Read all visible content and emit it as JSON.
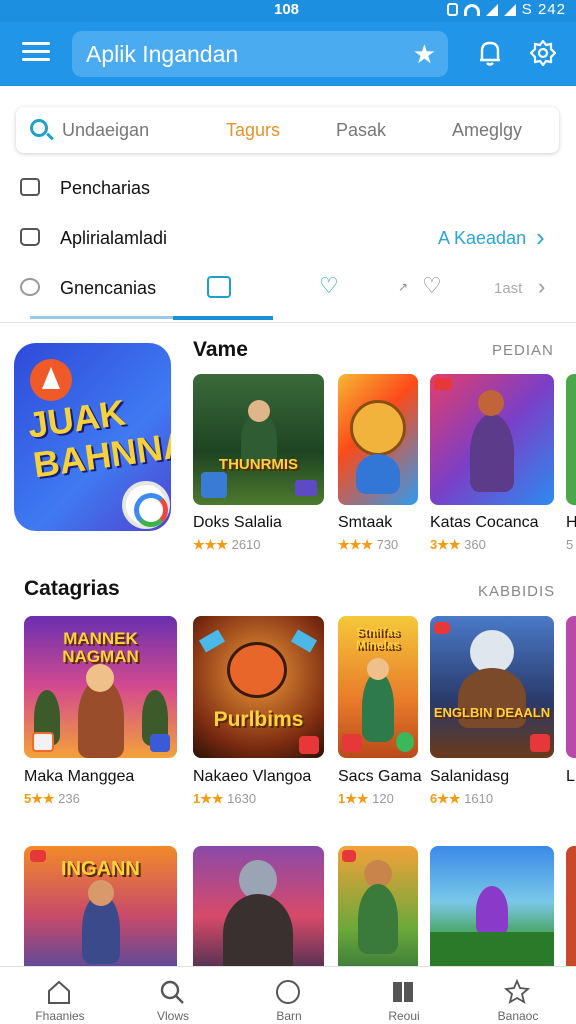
{
  "status_bar": {
    "time": "108",
    "battery": "S 242"
  },
  "app_bar": {
    "title": "Aplik Ingandan",
    "icons": [
      "menu-icon",
      "star-icon",
      "bell-icon",
      "gear-icon"
    ]
  },
  "tabs": [
    {
      "label": "Undaeigan",
      "active": false
    },
    {
      "label": "Tagurs",
      "active": true
    },
    {
      "label": "Pasak",
      "active": false
    },
    {
      "label": "Ameglgy",
      "active": false
    }
  ],
  "rows": {
    "row1": {
      "label": "Pencharias"
    },
    "row2": {
      "label": "Aplirialamladi",
      "right_text": "A Kaeadan"
    },
    "row3": {
      "label": "Gnencanias",
      "right_text": "1ast"
    }
  },
  "featured": {
    "title_line1": "JUAK",
    "title_line2": "BAHNNA"
  },
  "section1": {
    "title": "Vame",
    "link": "PEDIAN",
    "apps": [
      {
        "name": "Doks Salalia",
        "stars": "★★★",
        "count": "2610"
      },
      {
        "name": "Smtaak",
        "stars": "★★★",
        "count": "730"
      },
      {
        "name": "Katas Cocanca",
        "stars": "3★★",
        "count": "360"
      },
      {
        "name": "H",
        "stars": "",
        "count": "5"
      }
    ],
    "thumb_titles": [
      "THUNRMIS"
    ]
  },
  "section2": {
    "title": "Catagrias",
    "link": "KABBIDIS",
    "apps": [
      {
        "name": "Maka Manggea",
        "stars": "5★★",
        "count": "236",
        "thumb_title": "MANNEK NAGMAN"
      },
      {
        "name": "Nakaeo Vlangoa",
        "stars": "1★★",
        "count": "1630",
        "thumb_title": "Purlbims"
      },
      {
        "name": "Sacs Gama",
        "stars": "1★★",
        "count": "120",
        "thumb_title": "Stnilfas Minelas"
      },
      {
        "name": "Salanidasg",
        "stars": "6★★",
        "count": "1610",
        "thumb_title": "ENGLBIN DEAALN"
      },
      {
        "name": "L",
        "stars": "",
        "count": ""
      }
    ]
  },
  "section3": {
    "thumb_titles": [
      "INGANN"
    ]
  },
  "bottom_nav": [
    {
      "label": "Fhaanies",
      "icon": "home-icon"
    },
    {
      "label": "Vlows",
      "icon": "search-icon"
    },
    {
      "label": "Barn",
      "icon": "circle-icon"
    },
    {
      "label": "Reoui",
      "icon": "library-icon"
    },
    {
      "label": "Banaoc",
      "icon": "apps-icon"
    }
  ],
  "colors": {
    "primary": "#2196e8",
    "accent": "#2aa6d6",
    "tab_active": "#e8922a",
    "star": "#f39c12"
  }
}
